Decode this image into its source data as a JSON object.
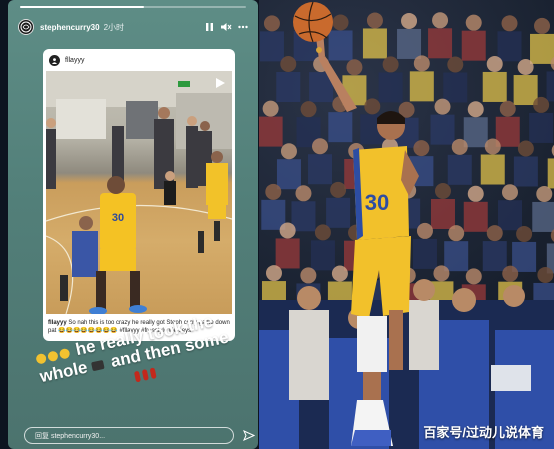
{
  "story": {
    "username": "stephencurry30",
    "time": "2小时",
    "progress": 0.55,
    "embedded_post": {
      "username": "fllayyy",
      "caption_user": "fllayyy",
      "caption_text": "So nah this is too crazy he really got Steph curry game down pat 😂😂😂😂😂😂😂😂 #fllayyy #freestyle #jerseys",
      "jersey_number": "30"
    },
    "sticker_text_line1": "he really took the",
    "sticker_text_line2": "whole",
    "sticker_text_line3": "and then some",
    "reply_placeholder": "回复 stephencurry30..."
  },
  "photo": {
    "player_jersey_number": "30",
    "watermark": "百家号/过动儿说体育"
  },
  "icons": {
    "pause": "pause-icon",
    "mute": "speaker-mute-icon",
    "more": "more-icon",
    "play": "play-icon",
    "send": "send-icon"
  }
}
